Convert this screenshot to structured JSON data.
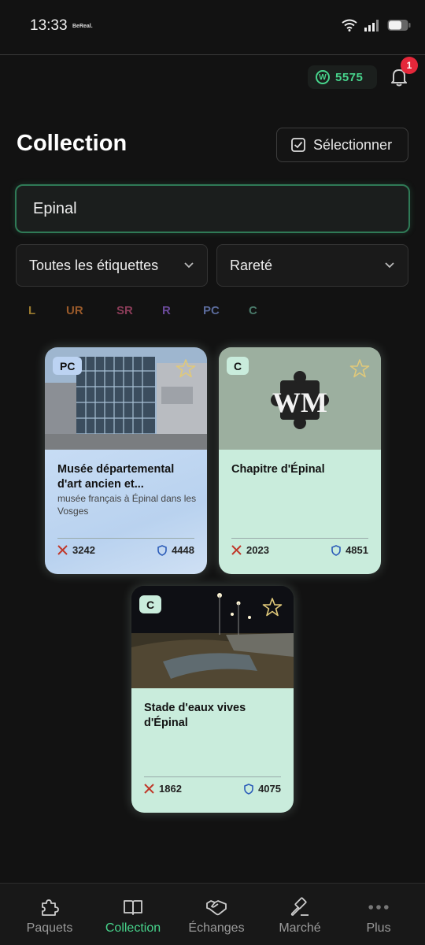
{
  "status_bar": {
    "time": "13:33",
    "app_name": "BeReal."
  },
  "header": {
    "coins": "5575",
    "coin_symbol": "W",
    "notification_count": "1"
  },
  "page": {
    "title": "Collection",
    "select_label": "Sélectionner"
  },
  "search": {
    "value": "Epinal"
  },
  "filters": {
    "tags_label": "Toutes les étiquettes",
    "rarity_label": "Rareté",
    "rarities": [
      {
        "label": "L",
        "color": "#9a7a2e"
      },
      {
        "label": "UR",
        "color": "#9a5a2a"
      },
      {
        "label": "SR",
        "color": "#8a3c58"
      },
      {
        "label": "R",
        "color": "#6a4a9a"
      },
      {
        "label": "PC",
        "color": "#5a6a9a"
      },
      {
        "label": "C",
        "color": "#4a7a6a"
      }
    ]
  },
  "cards": [
    {
      "rarity": "PC",
      "title": "Musée départemental d'art ancien et...",
      "subtitle": "musée français à Épinal dans les Vosges",
      "attack": "3242",
      "defense": "4448",
      "body_color": "#c4daf3",
      "badge_color": "#bcd3f2",
      "image": "museum-photo"
    },
    {
      "rarity": "C",
      "title": "Chapitre d'Épinal",
      "subtitle": "",
      "attack": "2023",
      "defense": "4851",
      "body_color": "#c9ecdc",
      "badge_color": "#c9ecdc",
      "image": "chapitre-logo",
      "logo_text": "WM"
    },
    {
      "rarity": "C",
      "title": "Stade d'eaux vives d'Épinal",
      "subtitle": "",
      "attack": "1862",
      "defense": "4075",
      "body_color": "#c9ecdc",
      "badge_color": "#c9ecdc",
      "image": "night-stadium-photo"
    }
  ],
  "nav": {
    "items": [
      {
        "label": "Paquets",
        "icon": "puzzle-icon"
      },
      {
        "label": "Collection",
        "icon": "book-icon",
        "active": true
      },
      {
        "label": "Échanges",
        "icon": "handshake-icon"
      },
      {
        "label": "Marché",
        "icon": "gavel-icon"
      },
      {
        "label": "Plus",
        "icon": "more-dots-icon"
      }
    ]
  }
}
